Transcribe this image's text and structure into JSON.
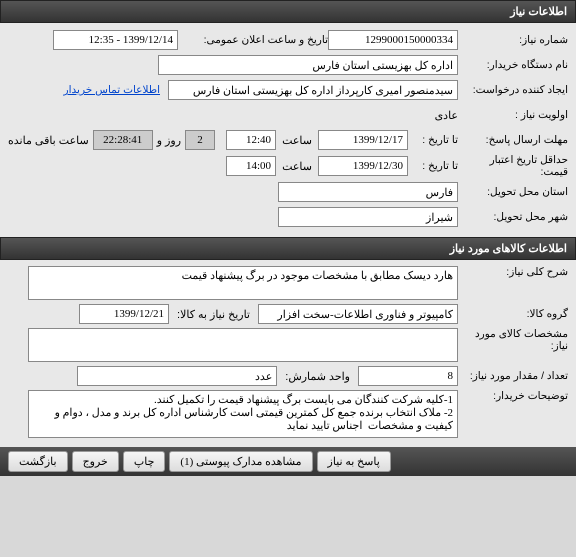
{
  "sections": {
    "need_info": "اطلاعات نیاز",
    "goods_info": "اطلاعات کالاهای مورد نیاز"
  },
  "fields": {
    "need_number_label": "شماره نیاز:",
    "need_number": "1299000150000334",
    "public_announce_label": "تاریخ و ساعت اعلان عمومی:",
    "public_announce": "1399/12/14 - 12:35",
    "buyer_org_label": "نام دستگاه خریدار:",
    "buyer_org": "اداره کل بهزیستی استان فارس",
    "requester_label": "ایجاد کننده درخواست:",
    "requester": "سیدمنصور امیری کارپرداز اداره کل بهزیستی استان فارس",
    "buyer_contact_link": "اطلاعات تماس خریدار",
    "priority_label": "اولویت نیاز :",
    "priority": "عادی",
    "response_deadline_label": "مهلت ارسال پاسخ:",
    "to_date_label": "تا تاریخ :",
    "deadline_date": "1399/12/17",
    "time_label": "ساعت",
    "deadline_time": "12:40",
    "days_count": "2",
    "days_label": "روز و",
    "countdown": "22:28:41",
    "remaining_label": "ساعت باقی مانده",
    "min_validity_label": "حداقل تاریخ اعتبار قیمت:",
    "validity_date": "1399/12/30",
    "validity_time": "14:00",
    "delivery_province_label": "استان محل تحویل:",
    "delivery_province": "فارس",
    "delivery_city_label": "شهر محل تحویل:",
    "delivery_city": "شیراز",
    "general_desc_label": "شرح کلی نیاز:",
    "general_desc": "هارد دیسک مطابق با مشخصات موجود در برگ پیشنهاد قیمت",
    "goods_group_label": "گروه کالا:",
    "goods_group": "کامپیوتر و فناوری اطلاعات-سخت افزار",
    "need_date_label": "تاریخ نیاز به کالا:",
    "need_date": "1399/12/21",
    "goods_spec_label": "مشخصات کالای مورد نیاز:",
    "goods_spec": "",
    "quantity_label": "تعداد / مقدار مورد نیاز:",
    "quantity": "8",
    "unit_label": "واحد شمارش:",
    "unit": "عدد",
    "buyer_notes_label": "توضیحات خریدار:",
    "buyer_notes": "1-کلیه شرکت کنندگان می بایست برگ پیشنهاد قیمت را تکمیل کنند.\n2- ملاک انتخاب برنده جمع کل کمترین قیمتی است کارشناس اداره کل برند و مدل ، دوام و کیفیت و مشخصات  اجناس تایید نماید"
  },
  "buttons": {
    "respond": "پاسخ به نیاز",
    "view_attachments": "مشاهده مدارک پیوستی (1)",
    "print": "چاپ",
    "exit": "خروج",
    "back": "بازگشت"
  }
}
